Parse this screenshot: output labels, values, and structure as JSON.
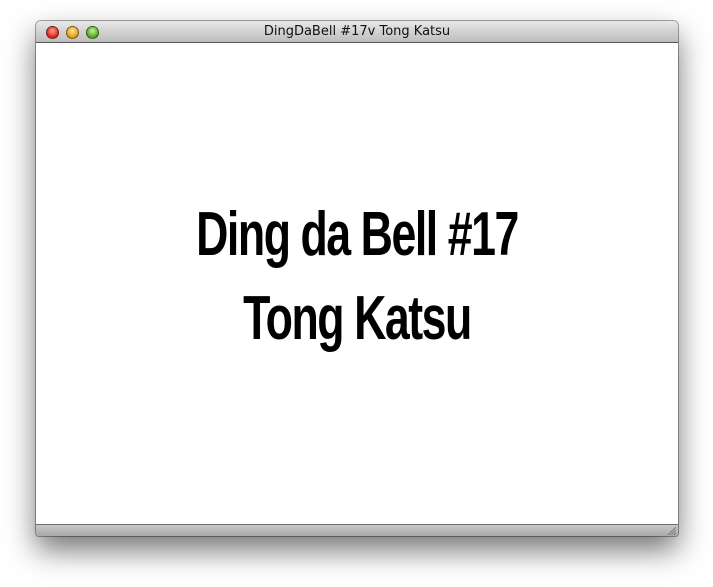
{
  "window": {
    "title": "DingDaBell #17v Tong Katsu"
  },
  "titlebar": {
    "buttons": [
      {
        "name": "close",
        "color": "#d8231a"
      },
      {
        "name": "minimize",
        "color": "#e09a12"
      },
      {
        "name": "zoom",
        "color": "#4fa51e"
      }
    ]
  },
  "content": {
    "line1": "Ding da Bell #17",
    "line2": "Tong Katsu"
  },
  "icons": {
    "resize": "resize-grip-icon"
  }
}
